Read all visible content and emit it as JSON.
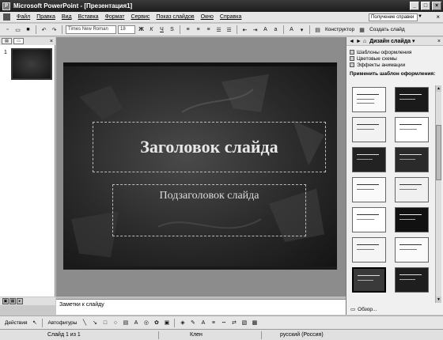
{
  "window": {
    "title": "Microsoft PowerPoint - [Презентация1]",
    "minimize": "_",
    "maximize": "□",
    "close": "×"
  },
  "menu": {
    "items": [
      "Файл",
      "Правка",
      "Вид",
      "Вставка",
      "Формат",
      "Сервис",
      "Показ слайдов",
      "Окно",
      "Справка"
    ],
    "help_placeholder": "Получение справки",
    "close_doc": "×"
  },
  "toolbar": {
    "font_name": "Times New Roman",
    "font_size": "18",
    "bold": "Ж",
    "italic": "К",
    "underline": "Ч",
    "shadow": "S",
    "design_label": "Конструктор",
    "new_slide_label": "Создать слайд"
  },
  "slide_pane": {
    "slide_number": "1",
    "tabs_close": "×"
  },
  "slide": {
    "title": "Заголовок слайда",
    "subtitle": "Подзаголовок слайда"
  },
  "notes": {
    "text": "Заметки к слайду"
  },
  "task_pane": {
    "title": "Дизайн слайда",
    "close": "×",
    "links": [
      "Шаблоны оформления",
      "Цветовые схемы",
      "Эффекты анимации"
    ],
    "apply_label": "Применить шаблон оформления:",
    "browse_label": "Обзор..."
  },
  "drawing_toolbar": {
    "draw_label": "Действия",
    "autoshapes_label": "Автофигуры"
  },
  "status": {
    "slide": "Слайд 1 из 1",
    "design": "Клен",
    "language": "русский (Россия)"
  }
}
